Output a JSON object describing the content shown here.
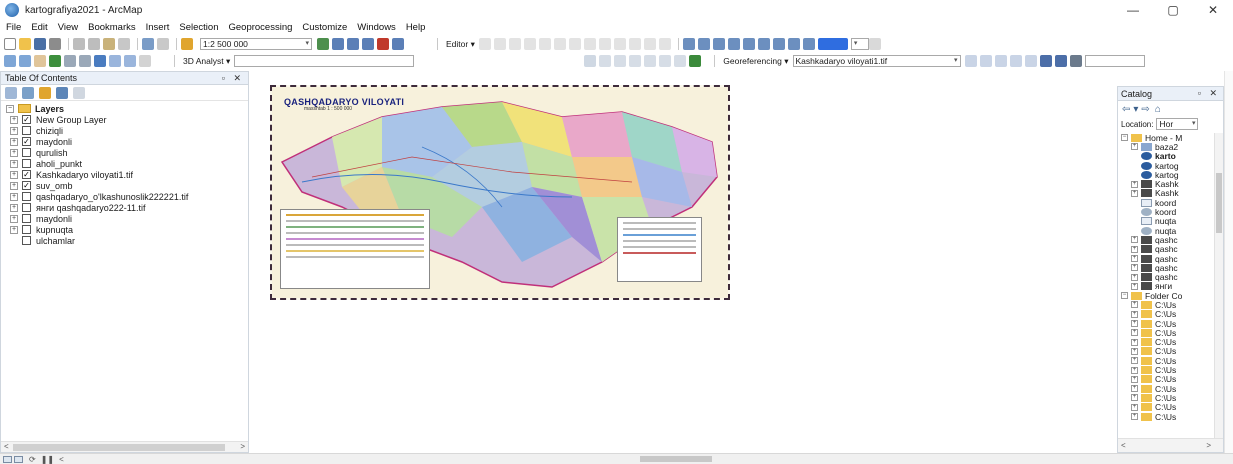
{
  "window": {
    "title": "kartografiya2021 - ArcMap",
    "controls": [
      "—",
      "▢",
      "✕"
    ]
  },
  "menu": [
    "File",
    "Edit",
    "View",
    "Bookmarks",
    "Insert",
    "Selection",
    "Geoprocessing",
    "Customize",
    "Windows",
    "Help"
  ],
  "toolbar1": {
    "scale_value": "1:2 500 000",
    "editor_label": "Editor ▾"
  },
  "toolbar2": {
    "analyst_label": "3D Analyst ▾",
    "georeferencing_label": "Georeferencing ▾",
    "georef_layer": "Kashkadaryo viloyati1.tif"
  },
  "toc": {
    "title": "Table Of Contents",
    "panel_controls": "▫ ✕",
    "root": "Layers",
    "layers": [
      {
        "name": "New Group Layer",
        "checked": true,
        "expandable": true
      },
      {
        "name": "chiziqli",
        "checked": false,
        "expandable": true
      },
      {
        "name": "maydonli",
        "checked": true,
        "expandable": true
      },
      {
        "name": "qurulish",
        "checked": false,
        "expandable": true
      },
      {
        "name": "aholi_punkt",
        "checked": false,
        "expandable": true
      },
      {
        "name": "Kashkadaryo viloyati1.tif",
        "checked": true,
        "expandable": true
      },
      {
        "name": "suv_omb",
        "checked": true,
        "expandable": true
      },
      {
        "name": "qashqadaryo_o'lkashunoslik222221.tif",
        "checked": false,
        "expandable": true
      },
      {
        "name": "янги qashqadaryo222-11.tif",
        "checked": false,
        "expandable": true
      },
      {
        "name": "maydonli",
        "checked": false,
        "expandable": true
      },
      {
        "name": "kupnuqta",
        "checked": false,
        "expandable": true
      },
      {
        "name": "ulchamlar",
        "checked": false,
        "expandable": false
      }
    ]
  },
  "map": {
    "title": "QASHQADARYO VILOYATI",
    "scale": "masshtab 1 : 500 000"
  },
  "catalog": {
    "title": "Catalog",
    "panel_controls": "▫ ✕",
    "location_label": "Location:",
    "location_value": "Hor",
    "items": [
      {
        "label": "Home - M",
        "type": "folder-home",
        "exp": "⊟"
      },
      {
        "label": "baza2",
        "type": "db",
        "exp": "⊞"
      },
      {
        "label": "karto",
        "type": "mxd",
        "exp": "",
        "bold": true
      },
      {
        "label": "kartog",
        "type": "mxd",
        "exp": ""
      },
      {
        "label": "kartog",
        "type": "mxd",
        "exp": ""
      },
      {
        "label": "Kashk",
        "type": "raster",
        "exp": "⊞"
      },
      {
        "label": "Kashk",
        "type": "raster",
        "exp": "⊞"
      },
      {
        "label": "koord",
        "type": "file",
        "exp": ""
      },
      {
        "label": "koord",
        "type": "globe",
        "exp": ""
      },
      {
        "label": "nuqta",
        "type": "file",
        "exp": ""
      },
      {
        "label": "nuqta",
        "type": "globe",
        "exp": ""
      },
      {
        "label": "qashc",
        "type": "raster",
        "exp": "⊞"
      },
      {
        "label": "qashc",
        "type": "raster",
        "exp": "⊞"
      },
      {
        "label": "qashc",
        "type": "raster",
        "exp": "⊞"
      },
      {
        "label": "qashc",
        "type": "raster",
        "exp": "⊞"
      },
      {
        "label": "qashc",
        "type": "raster",
        "exp": "⊞"
      },
      {
        "label": "янги",
        "type": "raster",
        "exp": "⊞"
      },
      {
        "label": "Folder Co",
        "type": "folder-conn",
        "exp": "⊟"
      },
      {
        "label": "C:\\Us",
        "type": "folder",
        "exp": "⊞"
      },
      {
        "label": "C:\\Us",
        "type": "folder",
        "exp": "⊞"
      },
      {
        "label": "C:\\Us",
        "type": "folder",
        "exp": "⊞"
      },
      {
        "label": "C:\\Us",
        "type": "folder",
        "exp": "⊞"
      },
      {
        "label": "C:\\Us",
        "type": "folder",
        "exp": "⊞"
      },
      {
        "label": "C:\\Us",
        "type": "folder",
        "exp": "⊞"
      },
      {
        "label": "C:\\Us",
        "type": "folder",
        "exp": "⊞"
      },
      {
        "label": "C:\\Us",
        "type": "folder",
        "exp": "⊞"
      },
      {
        "label": "C:\\Us",
        "type": "folder",
        "exp": "⊞"
      },
      {
        "label": "C:\\Us",
        "type": "folder",
        "exp": "⊞"
      },
      {
        "label": "C:\\Us",
        "type": "folder",
        "exp": "⊞"
      },
      {
        "label": "C:\\Us",
        "type": "folder",
        "exp": "⊞"
      },
      {
        "label": "C:\\Us",
        "type": "folder",
        "exp": "⊞"
      }
    ]
  },
  "colors": {
    "panel_header": "#eaf0f8",
    "map_border": "#3d2a3a",
    "map_title": "#1a237e",
    "folder": "#f0c24b"
  }
}
